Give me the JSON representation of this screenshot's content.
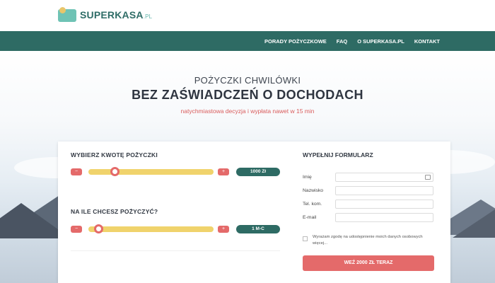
{
  "brand": {
    "name": "SUPERKASA",
    "suffix": ".PL"
  },
  "nav": {
    "items": [
      "PORADY POŻYCZKOWE",
      "FAQ",
      "O SUPERKASA.PL",
      "KONTAKT"
    ]
  },
  "hero": {
    "subtitle": "POŻYCZKI CHWILÓWKI",
    "title": "BEZ ZAŚWIADCZEŃ O DOCHODACH",
    "tagline": "natychmiastowa decyzja i wypłata nawet w 15 min"
  },
  "calculator": {
    "amount": {
      "title": "WYBIERZ KWOTĘ POŻYCZKI",
      "value": "1000 Zł",
      "minus": "−",
      "plus": "+",
      "level": 0.19
    },
    "period": {
      "title": "NA ILE CHCESZ POŻYCZYĆ?",
      "value": "1 M-C",
      "minus": "−",
      "plus": "+",
      "level": 0.05
    }
  },
  "form": {
    "title": "WYPEŁNIJ FORMULARZ",
    "fields": [
      {
        "label": "Imię"
      },
      {
        "label": "Nazwisko"
      },
      {
        "label": "Tel. kom."
      },
      {
        "label": "E-mail"
      }
    ],
    "consent": "Wyrażam zgodę na udostępnienie moich danych osobowych więcej...",
    "submit": "WEŹ 2000 ZŁ TERAZ"
  },
  "colors": {
    "primary": "#2e6b64",
    "accent": "#e46a6a",
    "slider": "#f0d36c"
  }
}
